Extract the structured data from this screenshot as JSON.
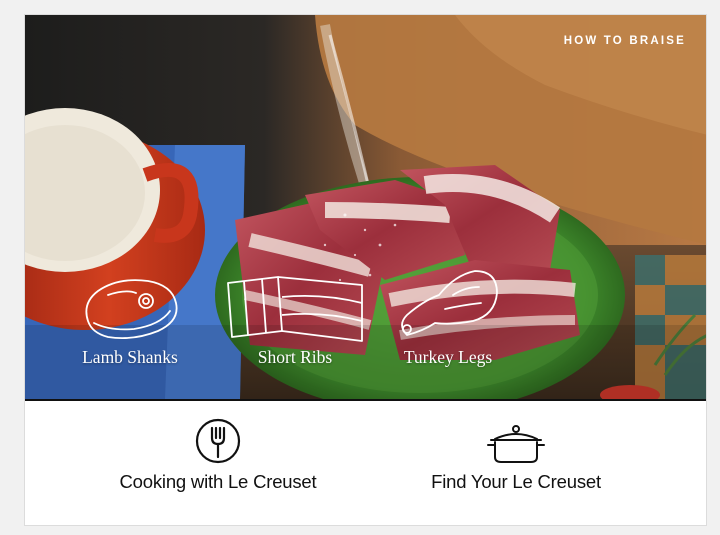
{
  "hero": {
    "label": "HOW TO BRAISE",
    "photo_subject": "Raw short ribs on a green plate being salted beside a red Dutch oven"
  },
  "cuts": [
    {
      "label": "Lamb Shanks",
      "icon": "lamb-shank-icon"
    },
    {
      "label": "Short Ribs",
      "icon": "short-ribs-icon"
    },
    {
      "label": "Turkey Legs",
      "icon": "turkey-leg-icon"
    }
  ],
  "links": [
    {
      "label": "Cooking with Le Creuset",
      "icon": "fork-icon"
    },
    {
      "label": "Find Your Le Creuset",
      "icon": "pot-icon"
    }
  ],
  "colors": {
    "pot_red": "#c8361c",
    "plate_green": "#3f8a2c",
    "meat_red": "#a83a45",
    "background": "#ffffff"
  }
}
